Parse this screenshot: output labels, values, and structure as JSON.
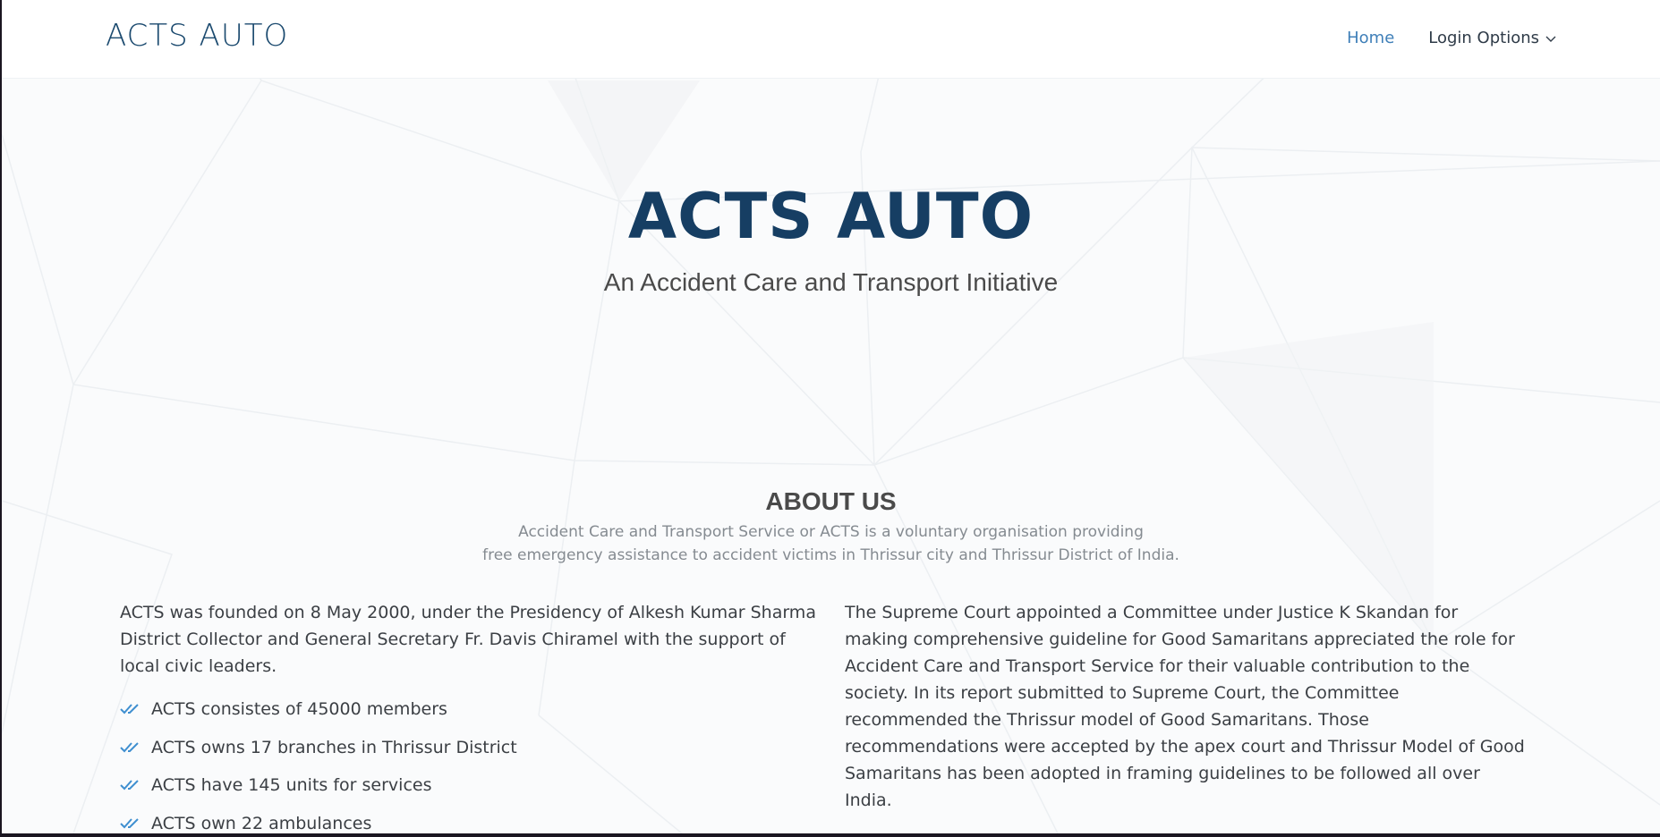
{
  "header": {
    "logo": "ACTS AUTO",
    "nav": {
      "home_label": "Home",
      "login_label": "Login Options",
      "login_icon": "chevron-down-icon"
    }
  },
  "hero": {
    "title": "ACTS AUTO",
    "subtitle": "An Accident Care and Transport Initiative"
  },
  "about": {
    "title": "ABOUT US",
    "description_line1": "Accident Care and Transport Service or ACTS is a voluntary organisation providing",
    "description_line2": "free emergency assistance to accident victims in Thrissur city and Thrissur District of India.",
    "left_paragraph": "ACTS was founded on 8 May 2000, under the Presidency of Alkesh Kumar Sharma District Collector and General Secretary Fr. Davis Chiramel with the support of local civic leaders.",
    "features": [
      "ACTS consistes of 45000 members",
      "ACTS owns 17 branches in Thrissur District",
      "ACTS have 145 units for services",
      "ACTS own 22 ambulances"
    ],
    "feature_icon": "double-check-icon",
    "right_paragraph": "The Supreme Court appointed a Committee under Justice K Skandan for making comprehensive guideline for Good Samaritans appreciated the role for Accident Care and Transport Service for their valuable contribution to the society. In its report submitted to Supreme Court, the Committee recommended the Thrissur model of Good Samaritans. Those recommendations were accepted by the apex court and Thrissur Model of Good Samaritans has been adopted in framing guidelines to be followed all over India."
  },
  "colors": {
    "brand": "#163e63",
    "nav_active": "#3f7fb8",
    "check": "#3f8fd0"
  }
}
